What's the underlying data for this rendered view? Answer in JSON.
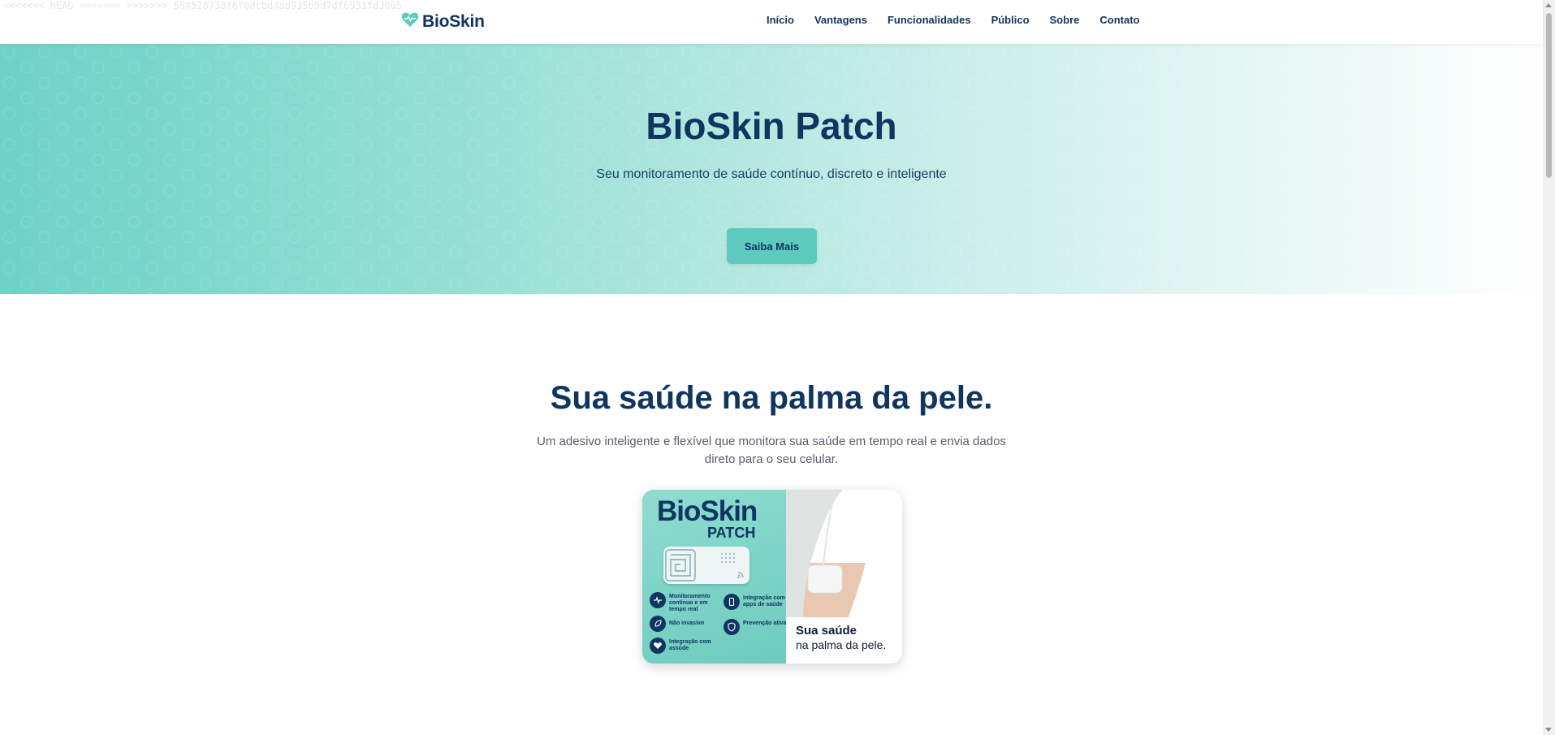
{
  "conflict_marker": "<<<<<<< HEAD ======= >>>>>>> 584528738f6f0dcbd4ad935b5d7df6931fd3005",
  "nav": {
    "brand": "BioSkin",
    "links": [
      "Início",
      "Vantagens",
      "Funcionalidades",
      "Público",
      "Sobre",
      "Contato"
    ]
  },
  "hero": {
    "title": "BioSkin Patch",
    "subtitle": "Seu monitoramento de saúde contínuo, discreto e inteligente",
    "cta": "Saiba Mais"
  },
  "intro": {
    "title": "Sua saúde na palma da pele.",
    "description": "Um adesivo inteligente e flexível que monitora sua saúde em tempo real e envia dados direto para o seu celular."
  },
  "product_image": {
    "brand": "BioSkin",
    "brand_sub": "PATCH",
    "features": [
      "Monitoramento contínuo e em tempo real",
      "Integração com apps de saúde",
      "Não invasivo",
      "Prevenção ativa",
      "Integração com assúde"
    ],
    "caption_line1": "Sua saúde",
    "caption_line2": "na palma da pele."
  },
  "colors": {
    "primary": "#0f3560",
    "accent": "#5ccabd",
    "hero_start": "#6ed2c5"
  }
}
